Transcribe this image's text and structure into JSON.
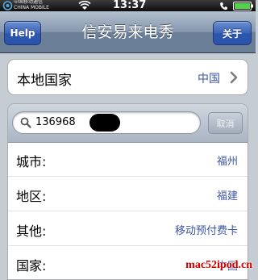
{
  "status_bar": {
    "carrier_line1": "中国移动通信",
    "carrier_line2": "CHINA MOBILE",
    "time": "13:37"
  },
  "nav": {
    "left_button": "Help",
    "title": "信安易来电秀",
    "right_button": "关于"
  },
  "country": {
    "label": "本地国家",
    "value": "中国"
  },
  "search": {
    "value": "136968",
    "cancel_label": "取消"
  },
  "results": [
    {
      "label": "城市:",
      "value": "福州"
    },
    {
      "label": "地区:",
      "value": "福建"
    },
    {
      "label": "其他:",
      "value": "移动预付费卡"
    },
    {
      "label": "国家:",
      "value": "中国"
    }
  ],
  "watermark": "mac52ipod.cn",
  "colors": {
    "link_blue": "#3b55a0",
    "nav_button_blue": "#2d56ad",
    "watermark_red": "#d40000"
  }
}
